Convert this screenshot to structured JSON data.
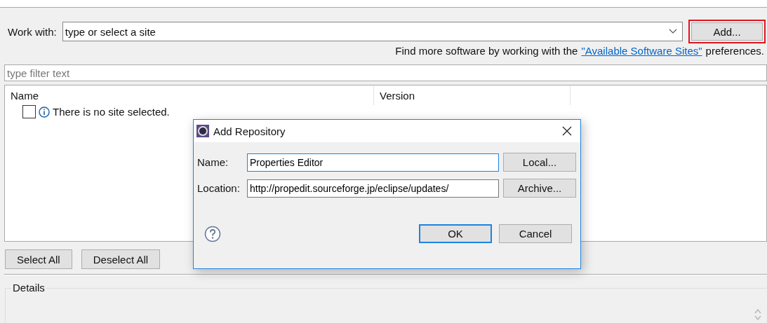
{
  "work_with": {
    "label": "Work with:",
    "placeholder": "type or select a site",
    "add_button": {
      "label": "Add...",
      "highlighted": true
    }
  },
  "hint": {
    "before": "Find more software by working with the",
    "link": "\"Available Software Sites\"",
    "after": "preferences."
  },
  "filter": {
    "placeholder": "type filter text"
  },
  "table": {
    "columns": [
      "Name",
      "Version"
    ],
    "rows": [
      {
        "checked": false,
        "message": "There is no site selected."
      }
    ]
  },
  "buttons": [
    "Select All",
    "Deselect All"
  ],
  "details": {
    "label": "Details"
  },
  "dialog": {
    "title": "Add Repository",
    "fields": [
      {
        "label": "Name:",
        "value": "Properties Editor",
        "focused": true,
        "button": "Local..."
      },
      {
        "label": "Location:",
        "value": "http://propedit.sourceforge.jp/eclipse/updates/",
        "focused": false,
        "button": "Archive..."
      }
    ],
    "buttons": [
      {
        "label": "OK",
        "default": true
      },
      {
        "label": "Cancel",
        "default": false
      }
    ]
  }
}
